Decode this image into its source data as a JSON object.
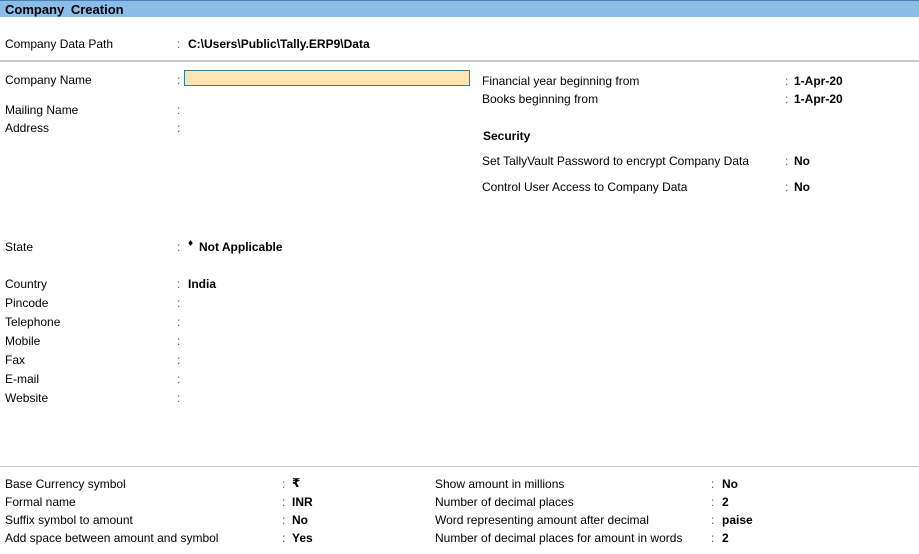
{
  "window": {
    "title": "Company Creation"
  },
  "data_path": {
    "label": "Company Data Path",
    "value": "C:\\Users\\Public\\Tally.ERP9\\Data"
  },
  "left_fields": {
    "company_name": {
      "label": "Company Name",
      "value": ""
    },
    "mailing_name": {
      "label": "Mailing Name",
      "value": ""
    },
    "address": {
      "label": "Address",
      "value": ""
    },
    "state": {
      "label": "State",
      "value": "Not Applicable",
      "marker": "♦"
    },
    "country": {
      "label": "Country",
      "value": "India"
    },
    "pincode": {
      "label": "Pincode",
      "value": ""
    },
    "telephone": {
      "label": "Telephone",
      "value": ""
    },
    "mobile": {
      "label": "Mobile",
      "value": ""
    },
    "fax": {
      "label": "Fax",
      "value": ""
    },
    "email": {
      "label": "E-mail",
      "value": ""
    },
    "website": {
      "label": "Website",
      "value": ""
    }
  },
  "right_fields": {
    "financial_year": {
      "label": "Financial year beginning from",
      "value": "1-Apr-20"
    },
    "books_beginning": {
      "label": "Books beginning from",
      "value": "1-Apr-20"
    },
    "security_heading": "Security",
    "tallyvault": {
      "label": "Set TallyVault Password to encrypt Company Data",
      "value": "No"
    },
    "user_access": {
      "label": "Control User Access to Company Data",
      "value": "No"
    }
  },
  "currency": {
    "left": [
      {
        "label": "Base Currency symbol",
        "value": "₹"
      },
      {
        "label": "Formal name",
        "value": "INR"
      },
      {
        "label": "Suffix symbol to amount",
        "value": "No"
      },
      {
        "label": "Add space between amount and symbol",
        "value": "Yes"
      }
    ],
    "right": [
      {
        "label": "Show amount in millions",
        "value": "No"
      },
      {
        "label": "Number of decimal places",
        "value": "2"
      },
      {
        "label": "Word representing amount after decimal",
        "value": "paise"
      },
      {
        "label": "Number of decimal places for amount in words",
        "value": "2"
      }
    ]
  },
  "separator": ":"
}
